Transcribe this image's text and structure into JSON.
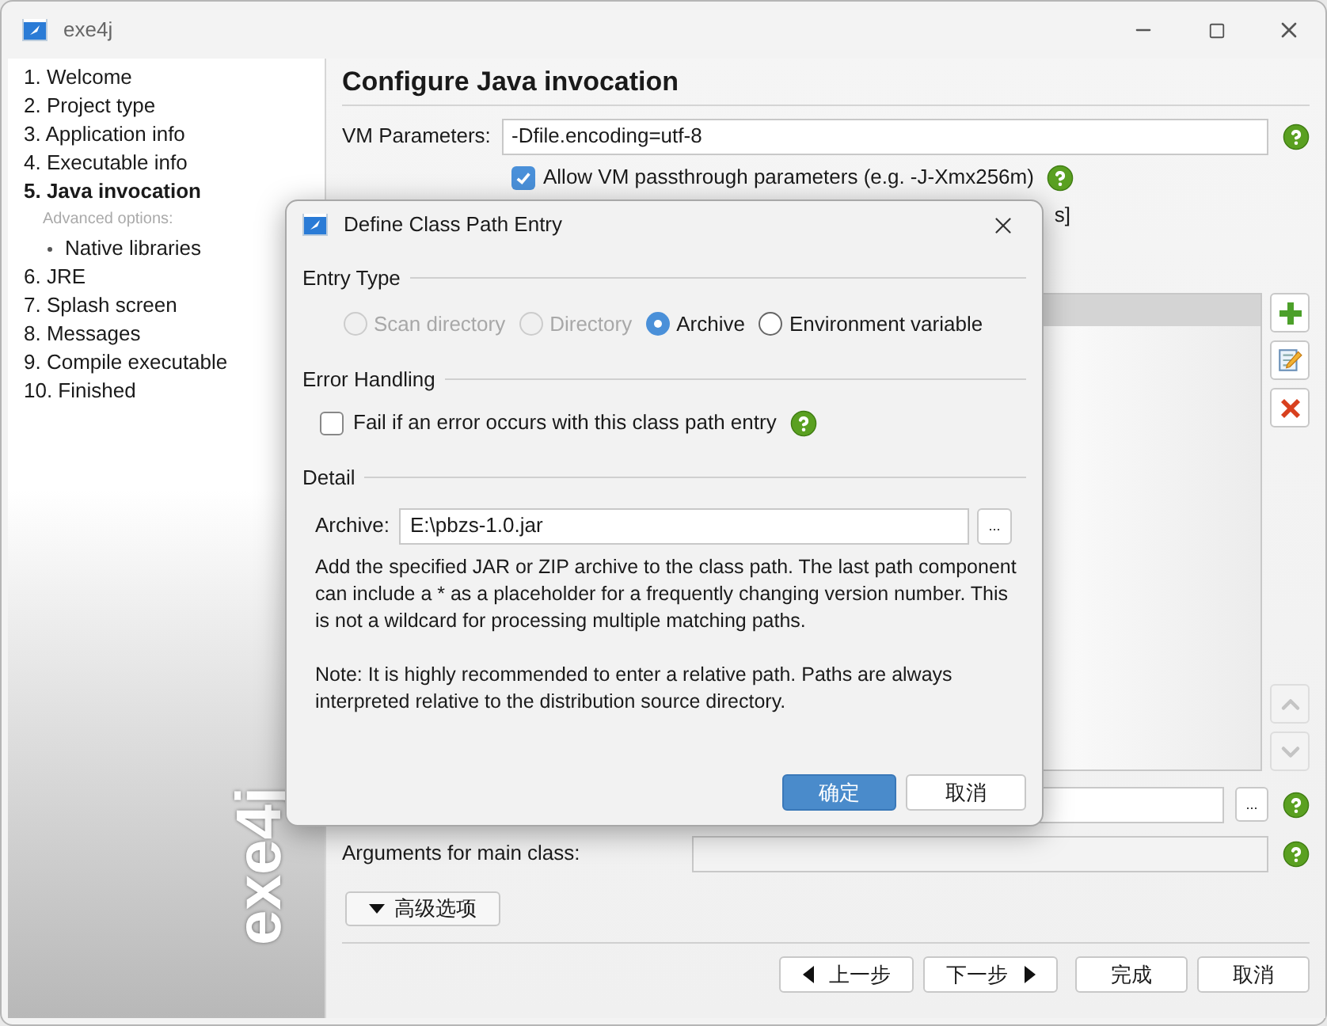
{
  "window": {
    "title": "exe4j"
  },
  "sidebar": {
    "watermark": "exe4j",
    "items": [
      {
        "label": "1. Welcome",
        "selected": false
      },
      {
        "label": "2. Project type",
        "selected": false
      },
      {
        "label": "3. Application info",
        "selected": false
      },
      {
        "label": "4. Executable info",
        "selected": false
      },
      {
        "label": "5. Java invocation",
        "selected": true,
        "subheading": "Advanced options:",
        "children": [
          {
            "label": "Native libraries",
            "selected": false
          }
        ]
      },
      {
        "label": "6. JRE",
        "selected": false
      },
      {
        "label": "7. Splash screen",
        "selected": false
      },
      {
        "label": "8. Messages",
        "selected": false
      },
      {
        "label": "9. Compile executable",
        "selected": false
      },
      {
        "label": "10. Finished",
        "selected": false
      }
    ]
  },
  "main": {
    "title": "Configure Java invocation",
    "vm_parameters": {
      "label": "VM Parameters:",
      "value": "-Dfile.encoding=utf-8"
    },
    "passthrough": {
      "label": "Allow VM passthrough parameters (e.g. -J-Xmx256m)",
      "checked": true
    },
    "covered_text": "s]",
    "class_path_rows": [
      {
        "selected": true
      }
    ],
    "side_buttons": [
      {
        "kind": "add",
        "disabled": false
      },
      {
        "kind": "edit",
        "disabled": false
      },
      {
        "kind": "delete",
        "disabled": false
      },
      {
        "kind": "up",
        "disabled": true
      },
      {
        "kind": "down",
        "disabled": true
      }
    ],
    "browse_button": "...",
    "arguments": {
      "label": "Arguments for main class:"
    },
    "advanced_button": "高级选项",
    "nav_buttons": [
      {
        "label": "上一步",
        "kind": "back"
      },
      {
        "label": "下一步",
        "kind": "next"
      },
      {
        "label": "完成",
        "kind": "plain"
      },
      {
        "label": "取消",
        "kind": "plain"
      }
    ]
  },
  "dialog": {
    "title": "Define Class Path Entry",
    "entry_type": {
      "heading": "Entry Type",
      "options": [
        {
          "label": "Scan directory",
          "selected": false,
          "disabled": true
        },
        {
          "label": "Directory",
          "selected": false,
          "disabled": true
        },
        {
          "label": "Archive",
          "selected": true,
          "disabled": false
        },
        {
          "label": "Environment variable",
          "selected": false,
          "disabled": false
        }
      ]
    },
    "error_handling": {
      "heading": "Error Handling",
      "label": "Fail if an error occurs with this class path entry",
      "checked": false
    },
    "detail": {
      "heading": "Detail",
      "label": "Archive:",
      "value": "E:\\pbzs-1.0.jar",
      "browse_button": "...",
      "description": "Add the specified JAR or ZIP archive to the class path. The last path component can include a * as a placeholder for a frequently changing version number. This is not a wildcard for processing multiple matching paths.",
      "note": "Note: It is highly recommended to enter a relative path. Paths are always interpreted relative to the distribution source directory."
    },
    "buttons": [
      {
        "label": "确定",
        "kind": "primary"
      },
      {
        "label": "取消",
        "kind": "plain"
      }
    ]
  }
}
